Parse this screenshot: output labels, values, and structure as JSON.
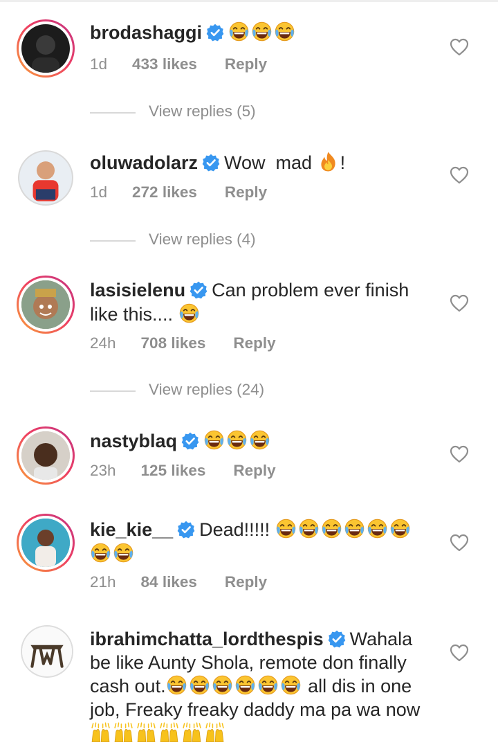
{
  "comments": [
    {
      "user": "brodashaggi",
      "text": "",
      "emoji_count": 3,
      "time": "1d",
      "likes": "433 likes",
      "reply": "Reply"
    },
    {
      "user": "oluwadolarz",
      "text": "Wow  mad",
      "suffix": "!",
      "time": "1d",
      "likes": "272 likes",
      "reply": "Reply"
    },
    {
      "user": "lasisielenu",
      "text": "Can problem ever finish",
      "text2": "like this....",
      "time": "24h",
      "likes": "708 likes",
      "reply": "Reply"
    },
    {
      "user": "nastyblaq",
      "text": "",
      "time": "23h",
      "likes": "125 likes",
      "reply": "Reply"
    },
    {
      "user": "kie_kie__",
      "text": "Dead!!!!!",
      "time": "21h",
      "likes": "84 likes",
      "reply": "Reply"
    },
    {
      "user": "ibrahimchatta_lordthespis",
      "text": "Wahala",
      "text2": "be like Aunty Shola, remote don finally",
      "text3": "cash out.",
      "text3b": "all dis in one",
      "text4": "job, Freaky freaky daddy ma pa wa now"
    }
  ],
  "view_replies": [
    "View replies (5)",
    "View replies (4)",
    "View replies (24)"
  ],
  "icons": {
    "verified": "verified-badge-icon",
    "heart": "heart-outline-icon",
    "laugh": "face-with-tears-of-joy-emoji",
    "fire": "fire-emoji",
    "hands": "raising-hands-emoji"
  },
  "colors": {
    "verified": "#3897f0",
    "meta": "#8e8e8e",
    "text": "#262626"
  }
}
